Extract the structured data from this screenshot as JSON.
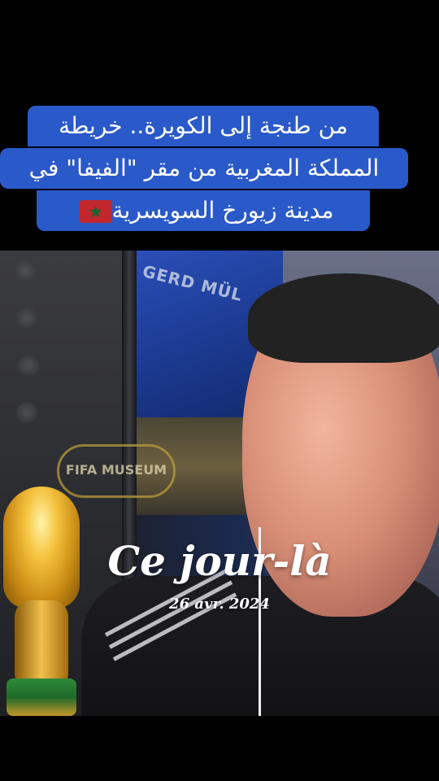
{
  "caption": {
    "line1": "من طنجة إلى الكويرة.. خريطة",
    "line2": "المملكة المغربية من مقر \"الفيفا\" في",
    "line3": "مدينة زيورخ السويسرية"
  },
  "scene": {
    "screen_text": "GERD MÜL",
    "museum_sign_text": "FIFA MUSEUM",
    "flag_icon": "morocco-flag-icon"
  },
  "memory": {
    "title": "Ce jour-là",
    "date": "26 avr. 2024"
  },
  "colors": {
    "caption_bg": "#2a59c9",
    "caption_text": "#ffffff",
    "letterbox": "#000000"
  }
}
